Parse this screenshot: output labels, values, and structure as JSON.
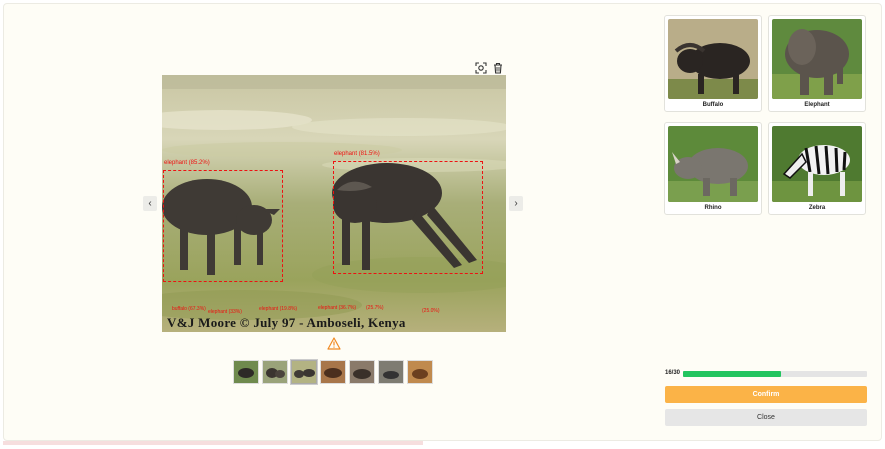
{
  "viewer": {
    "detections": [
      {
        "label": "elephant (85.2%)"
      },
      {
        "label": "elephant (81.5%)"
      }
    ],
    "small_detections": [
      "buffalo (67.3%)",
      "elephant (33%)",
      "elephant (19.8%)",
      "elephant (36.7%)",
      "(25.7%)",
      "(25.0%)"
    ],
    "watermark": "V&J Moore © July 97 - Amboseli, Kenya",
    "thumbnails": [
      "buffalo-1",
      "buffalo-2",
      "buffalo-3",
      "buffalo-4",
      "buffalo-5",
      "buffalo-6",
      "buffalo-7"
    ],
    "active_thumbnail": 2
  },
  "options": [
    {
      "label": "Buffalo"
    },
    {
      "label": "Elephant"
    },
    {
      "label": "Rhino"
    },
    {
      "label": "Zebra"
    }
  ],
  "progress": {
    "text": "16/30",
    "fraction": 0.5333
  },
  "buttons": {
    "confirm": "Confirm",
    "close": "Close"
  },
  "colors": {
    "accent": "#fbb347",
    "progress": "#22c55e",
    "detection": "#ee1111"
  }
}
